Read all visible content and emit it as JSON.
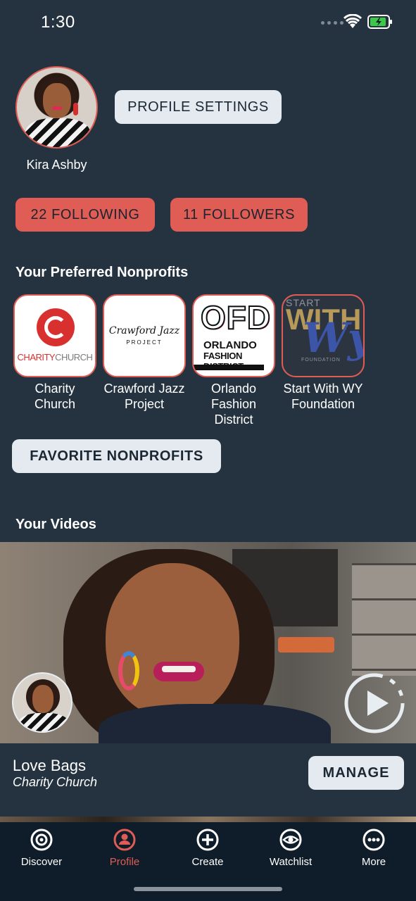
{
  "status_bar": {
    "time": "1:30"
  },
  "profile": {
    "name": "Kira Ashby",
    "settings_label": "PROFILE SETTINGS",
    "following_label": "22 FOLLOWING",
    "followers_label": "11 FOLLOWERS"
  },
  "nonprofits": {
    "title": "Your Preferred Nonprofits",
    "items": [
      {
        "label": "Charity Church",
        "logo_text": "CHARITY",
        "logo_text_2": "CHURCH",
        "logo_letter": "C"
      },
      {
        "label": "Crawford Jazz Project",
        "logo_text": "Crawford Jazz",
        "logo_sub": "PROJECT"
      },
      {
        "label": "Orlando Fashion District",
        "logo_big": "OFD",
        "logo_line1": "ORLANDO",
        "logo_line2": "FASHION DISTRICT"
      },
      {
        "label": "Start With WY Foundation",
        "logo_start": "START",
        "logo_with": "WITH",
        "logo_script": "Wy",
        "logo_foundation": "FOUNDATION"
      }
    ],
    "favorite_button": "FAVORITE NONPROFITS"
  },
  "videos": {
    "title": "Your Videos",
    "items": [
      {
        "title": "Love Bags",
        "organization": "Charity Church",
        "manage_label": "MANAGE"
      }
    ]
  },
  "tab_bar": {
    "tabs": [
      {
        "label": "Discover",
        "icon": "discover-icon"
      },
      {
        "label": "Profile",
        "icon": "profile-icon",
        "active": true
      },
      {
        "label": "Create",
        "icon": "create-icon"
      },
      {
        "label": "Watchlist",
        "icon": "watchlist-icon"
      },
      {
        "label": "More",
        "icon": "more-icon"
      }
    ]
  },
  "colors": {
    "background": "#253341",
    "accent_red": "#e05d55",
    "light_button": "#e4eaef",
    "tab_bar": "#0f1c29"
  }
}
